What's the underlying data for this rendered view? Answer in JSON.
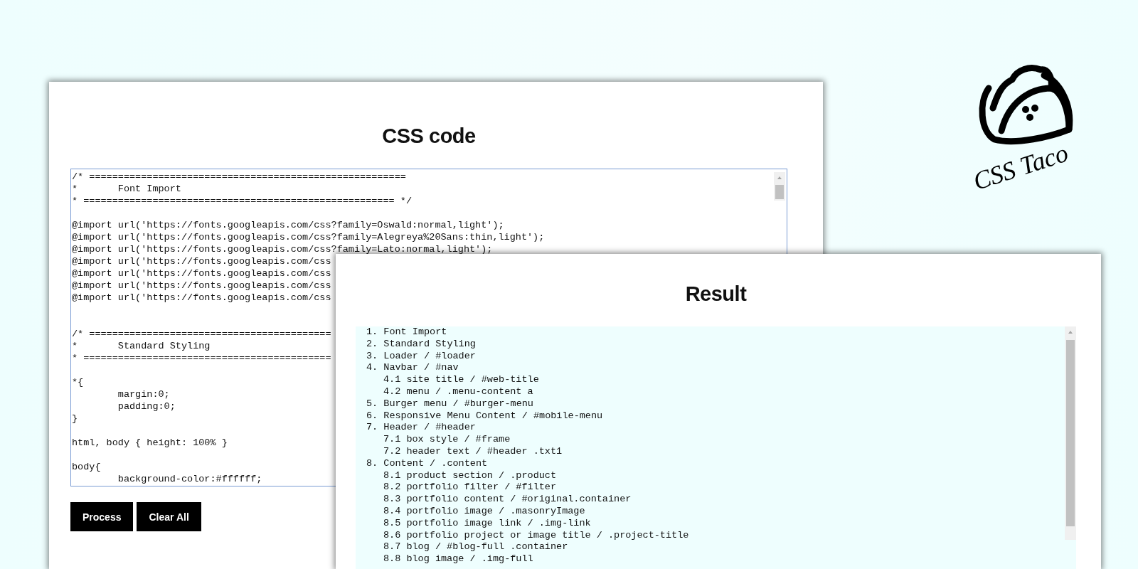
{
  "code_panel": {
    "title": "CSS code",
    "code": "/* =======================================================\n*\tFont Import\n* ====================================================== */\n\n@import url('https://fonts.googleapis.com/css?family=Oswald:normal,light');\n@import url('https://fonts.googleapis.com/css?family=Alegreya%20Sans:thin,light');\n@import url('https://fonts.googleapis.com/css?family=Lato:normal,light');\n@import url('https://fonts.googleapis.com/css\n@import url('https://fonts.googleapis.com/css\n@import url('https://fonts.googleapis.com/css\n@import url('https://fonts.googleapis.com/css\n\n\n/* ==========================================\n*\tStandard Styling\n* ===========================================\n\n*{\n\tmargin:0;\n\tpadding:0;\n}\n\nhtml, body { height: 100% }\n\nbody{\n\tbackground-color:#ffffff;",
    "buttons": [
      "Process",
      "Clear All"
    ]
  },
  "result_panel": {
    "title": "Result",
    "outline": [
      {
        "text": "1. Font Import"
      },
      {
        "text": "2. Standard Styling"
      },
      {
        "text": "3. Loader / #loader"
      },
      {
        "text": "4. Navbar / #nav",
        "children": [
          {
            "text": "4.1 site title / #web-title"
          },
          {
            "text": "4.2 menu / .menu-content a"
          }
        ]
      },
      {
        "text": "5. Burger menu / #burger-menu"
      },
      {
        "text": "6. Responsive Menu Content / #mobile-menu"
      },
      {
        "text": "7. Header / #header",
        "children": [
          {
            "text": "7.1 box style / #frame"
          },
          {
            "text": "7.2 header text / #header .txt1"
          }
        ]
      },
      {
        "text": "8. Content / .content",
        "children": [
          {
            "text": "8.1 product section / .product"
          },
          {
            "text": "8.2 portfolio filter / #filter"
          },
          {
            "text": "8.3 portfolio content / #original.container"
          },
          {
            "text": "8.4 portfolio image / .masonryImage"
          },
          {
            "text": "8.5 portfolio image link / .img-link"
          },
          {
            "text": "8.6 portfolio project or image title / .project-title"
          },
          {
            "text": "8.7 blog / #blog-full .container"
          },
          {
            "text": "8.8 blog image / .img-full"
          }
        ]
      }
    ]
  },
  "logo": {
    "text": "CSS Taco"
  }
}
